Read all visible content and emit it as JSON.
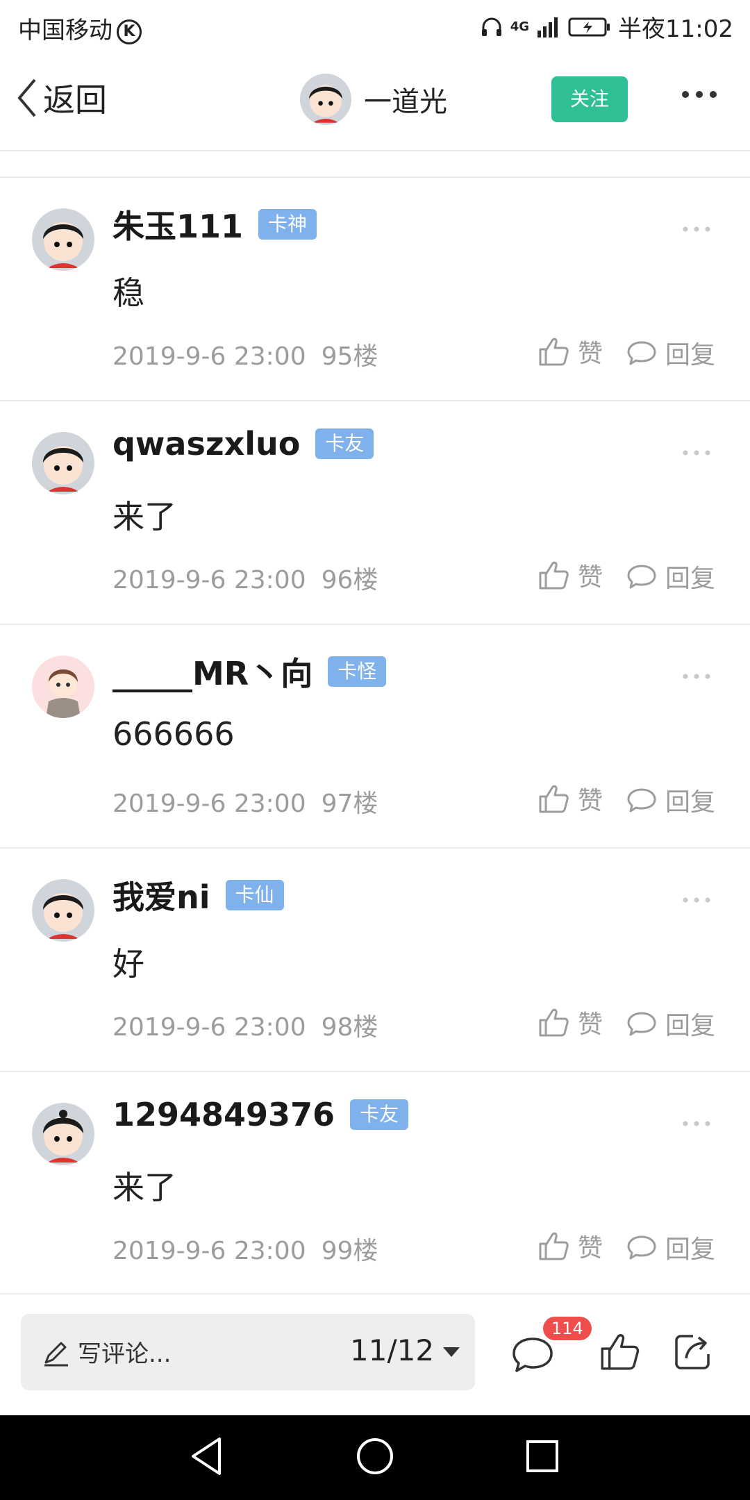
{
  "status": {
    "carrier": "中国移动",
    "carrier_badge": "K",
    "network": "4G",
    "time": "半夜11:02"
  },
  "header": {
    "back_label": "返回",
    "author_name": "一道光",
    "follow_label": "关注"
  },
  "comments": [
    {
      "name": "朱玉111",
      "badge": "卡神",
      "text": "稳",
      "date": "2019-9-6 23:00",
      "floor": "95楼",
      "like": "赞",
      "reply": "回复"
    },
    {
      "name": "qwaszxluo",
      "badge": "卡友",
      "text": "来了",
      "date": "2019-9-6 23:00",
      "floor": "96楼",
      "like": "赞",
      "reply": "回复"
    },
    {
      "name": "_____MR丶向",
      "badge": "卡怪",
      "text": "666666",
      "date": "2019-9-6 23:00",
      "floor": "97楼",
      "like": "赞",
      "reply": "回复"
    },
    {
      "name": "我爱ni",
      "badge": "卡仙",
      "text": "好",
      "date": "2019-9-6 23:00",
      "floor": "98楼",
      "like": "赞",
      "reply": "回复"
    },
    {
      "name": "1294849376",
      "badge": "卡友",
      "text": "来了",
      "date": "2019-9-6 23:00",
      "floor": "99楼",
      "like": "赞",
      "reply": "回复"
    }
  ],
  "bottom": {
    "write_placeholder": "写评论...",
    "page_indicator": "11/12",
    "comment_count": "114"
  },
  "colors": {
    "accent": "#2fbf95",
    "badge": "#7fb1ec",
    "notify": "#f04d4d"
  }
}
